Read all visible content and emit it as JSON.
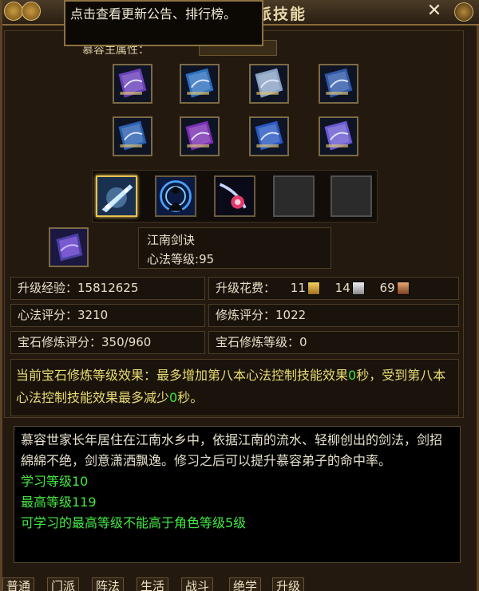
{
  "window": {
    "title": "派技能",
    "close_label": "✕"
  },
  "tooltip": {
    "text": "点击查看更新公告、排行榜。"
  },
  "header": {
    "attribute_label": "慕容主属性："
  },
  "book_grid": [
    {
      "name": "book-1",
      "color": "#6a3fb8"
    },
    {
      "name": "book-2",
      "color": "#2e6fbe"
    },
    {
      "name": "book-3",
      "color": "#8aa2c2"
    },
    {
      "name": "book-4",
      "color": "#3058a8"
    },
    {
      "name": "book-5",
      "color": "#2a5fb0"
    },
    {
      "name": "book-6",
      "color": "#7a2fb0"
    },
    {
      "name": "book-7",
      "color": "#2a58c0"
    },
    {
      "name": "book-8",
      "color": "#6a5ad0"
    }
  ],
  "skills": [
    {
      "name": "sword-strike-skill",
      "state": "selected"
    },
    {
      "name": "meditation-skill",
      "state": "normal"
    },
    {
      "name": "spin-slash-skill",
      "state": "normal"
    },
    {
      "name": "empty-slot",
      "state": "empty"
    },
    {
      "name": "empty-slot",
      "state": "empty"
    }
  ],
  "selected_skill": {
    "name": "江南剑诀",
    "level_label": "心法等级",
    "level_value": ":95"
  },
  "stats": {
    "upgrade_exp_label": "升级经验：",
    "upgrade_exp_value": "15812625",
    "upgrade_cost_label": "升级花费：",
    "cost_gold": "11",
    "cost_silver": "14",
    "cost_copper": "69",
    "xinfa_score_label": "心法评分：",
    "xinfa_score_value": "3210",
    "practice_score_label": "修炼评分：",
    "practice_score_value": "1022",
    "gem_score_label": "宝石修炼评分：",
    "gem_score_value": "350/960",
    "gem_level_label": "宝石修炼等级：",
    "gem_level_value": "0"
  },
  "gem_effect": {
    "part1": "当前宝石修炼等级效果：最多增加第八本心法控制技能效果",
    "val1": "0",
    "part2": "秒，受到第八本心法控制技能效果最多减少",
    "val2": "0",
    "part3": "秒。"
  },
  "description": {
    "text": "慕容世家长年居住在江南水乡中，依据江南的流水、轻柳创出的剑法，剑招綿綿不绝，剑意潇洒飘逸。修习之后可以提升慕容弟子的命中率。",
    "learn_level": "学习等级10",
    "max_level": "最高等级119",
    "limit_note": "可学习的最高等级不能高于角色等级5级"
  },
  "bottom_tabs": [
    "普通",
    "门派",
    "阵法",
    "生活",
    "战斗",
    "绝学",
    "升级"
  ]
}
